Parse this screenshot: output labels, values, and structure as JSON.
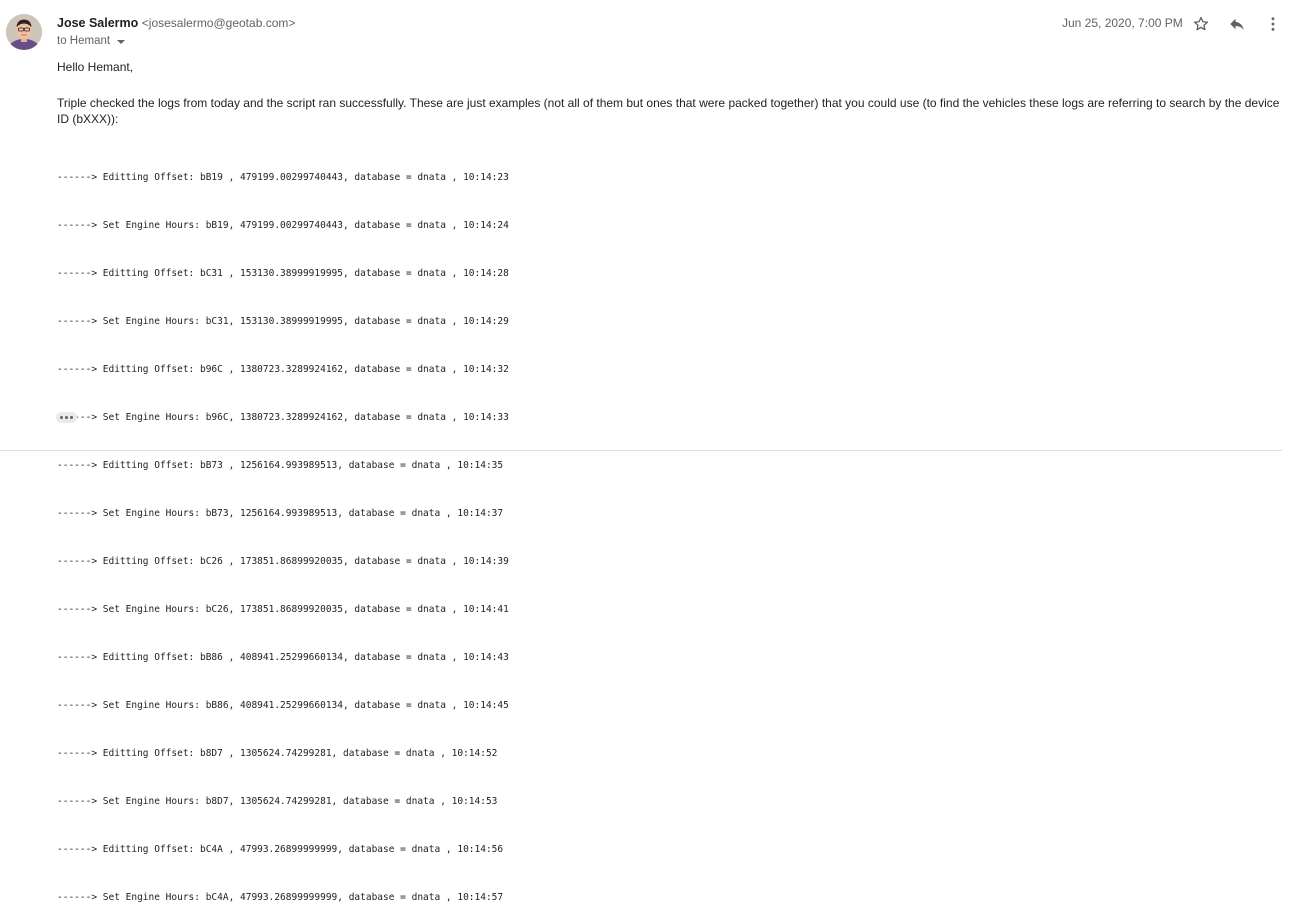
{
  "message": {
    "sender_name": "Jose Salermo",
    "sender_email": "<josesalermo@geotab.com>",
    "recipient": "to Hemant",
    "date": "Jun 25, 2020, 7:00 PM",
    "greeting": "Hello Hemant,",
    "paragraph": "Triple checked the logs from today and the script ran successfully. These are just examples (not all of them but ones that were packed together) that you could use (to find the vehicles these logs are referring to search by the device ID (bXXX)):",
    "log_lines": [
      "------> Editting Offset: bB19 , 479199.00299740443, database = dnata , 10:14:23",
      "------> Set Engine Hours: bB19, 479199.00299740443, database = dnata , 10:14:24",
      "------> Editting Offset: bC31 , 153130.38999919995, database = dnata , 10:14:28",
      "------> Set Engine Hours: bC31, 153130.38999919995, database = dnata , 10:14:29",
      "------> Editting Offset: b96C , 1380723.3289924162, database = dnata , 10:14:32",
      "------> Set Engine Hours: b96C, 1380723.3289924162, database = dnata , 10:14:33",
      "------> Editting Offset: bB73 , 1256164.993989513, database = dnata , 10:14:35",
      "------> Set Engine Hours: bB73, 1256164.993989513, database = dnata , 10:14:37",
      "------> Editting Offset: bC26 , 173851.86899920035, database = dnata , 10:14:39",
      "------> Set Engine Hours: bC26, 173851.86899920035, database = dnata , 10:14:41",
      "------> Editting Offset: bB86 , 408941.25299660134, database = dnata , 10:14:43",
      "------> Set Engine Hours: bB86, 408941.25299660134, database = dnata , 10:14:45",
      "------> Editting Offset: b8D7 , 1305624.74299281, database = dnata , 10:14:52",
      "------> Set Engine Hours: b8D7, 1305624.74299281, database = dnata , 10:14:53",
      "------> Editting Offset: bC4A , 47993.26899999999, database = dnata , 10:14:56",
      "------> Set Engine Hours: bC4A, 47993.26899999999, database = dnata , 10:14:57"
    ]
  },
  "icons": {
    "star": "star-icon",
    "reply": "reply-icon",
    "more": "more-vert-icon",
    "dropdown": "chevron-down-icon",
    "show_trimmed": "ellipsis-icon"
  },
  "colors": {
    "icon": "#5f6368",
    "text": "#222222",
    "muted": "#5f6368"
  }
}
